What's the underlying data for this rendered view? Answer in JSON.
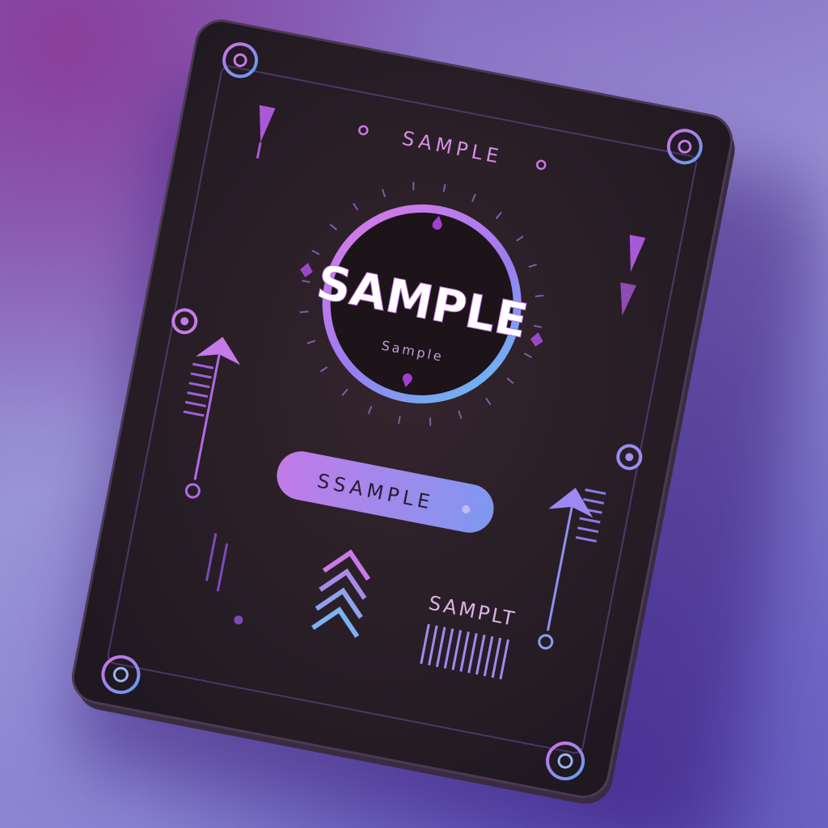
{
  "card": {
    "top_label": "SAMPLE",
    "center_title": "SAMPLE",
    "center_subtitle": "Sample",
    "pill_label": "SSAMPLE",
    "bottom_label": "SAMPLT"
  },
  "colors": {
    "card_body": "#2b1e26",
    "accent_purple": "#b06ae6",
    "accent_blue": "#6aa3f0",
    "accent_pink": "#d56ad8",
    "title_text": "#ffffff"
  },
  "icons": [
    "target-icon",
    "arrow-up-icon",
    "chevron-stack-icon",
    "arrow-down-icon"
  ]
}
